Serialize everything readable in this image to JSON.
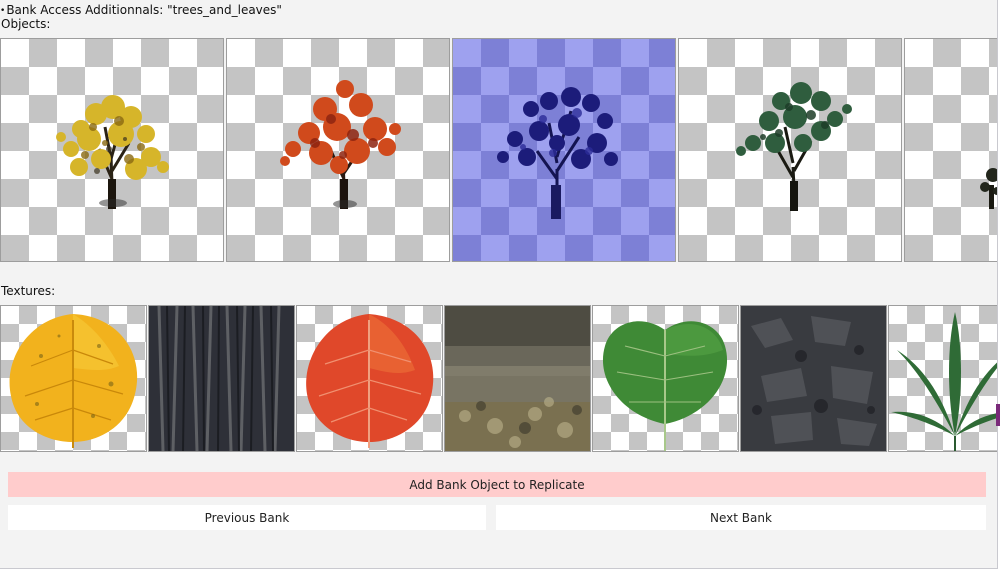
{
  "header": {
    "title": "Bank Access Additionnals: \"trees_and_leaves\""
  },
  "sections": {
    "objects_label": "Objects:",
    "textures_label": "Textures:"
  },
  "objects": [
    {
      "name": "yellow-tree",
      "selected": false
    },
    {
      "name": "red-tree",
      "selected": false
    },
    {
      "name": "blue-tree",
      "selected": true
    },
    {
      "name": "green-tree",
      "selected": false
    },
    {
      "name": "partial-tree",
      "selected": false
    }
  ],
  "textures": [
    {
      "name": "yellow-leaf"
    },
    {
      "name": "dark-bark"
    },
    {
      "name": "red-leaf"
    },
    {
      "name": "grass-ground"
    },
    {
      "name": "green-leaf"
    },
    {
      "name": "dark-rock"
    },
    {
      "name": "cannabis-leaf"
    }
  ],
  "buttons": {
    "add_label": "Add Bank Object to Replicate",
    "prev_label": "Previous Bank",
    "next_label": "Next Bank"
  },
  "colors": {
    "selection": "#9ea1ef",
    "add_button": "#ffcccc"
  }
}
